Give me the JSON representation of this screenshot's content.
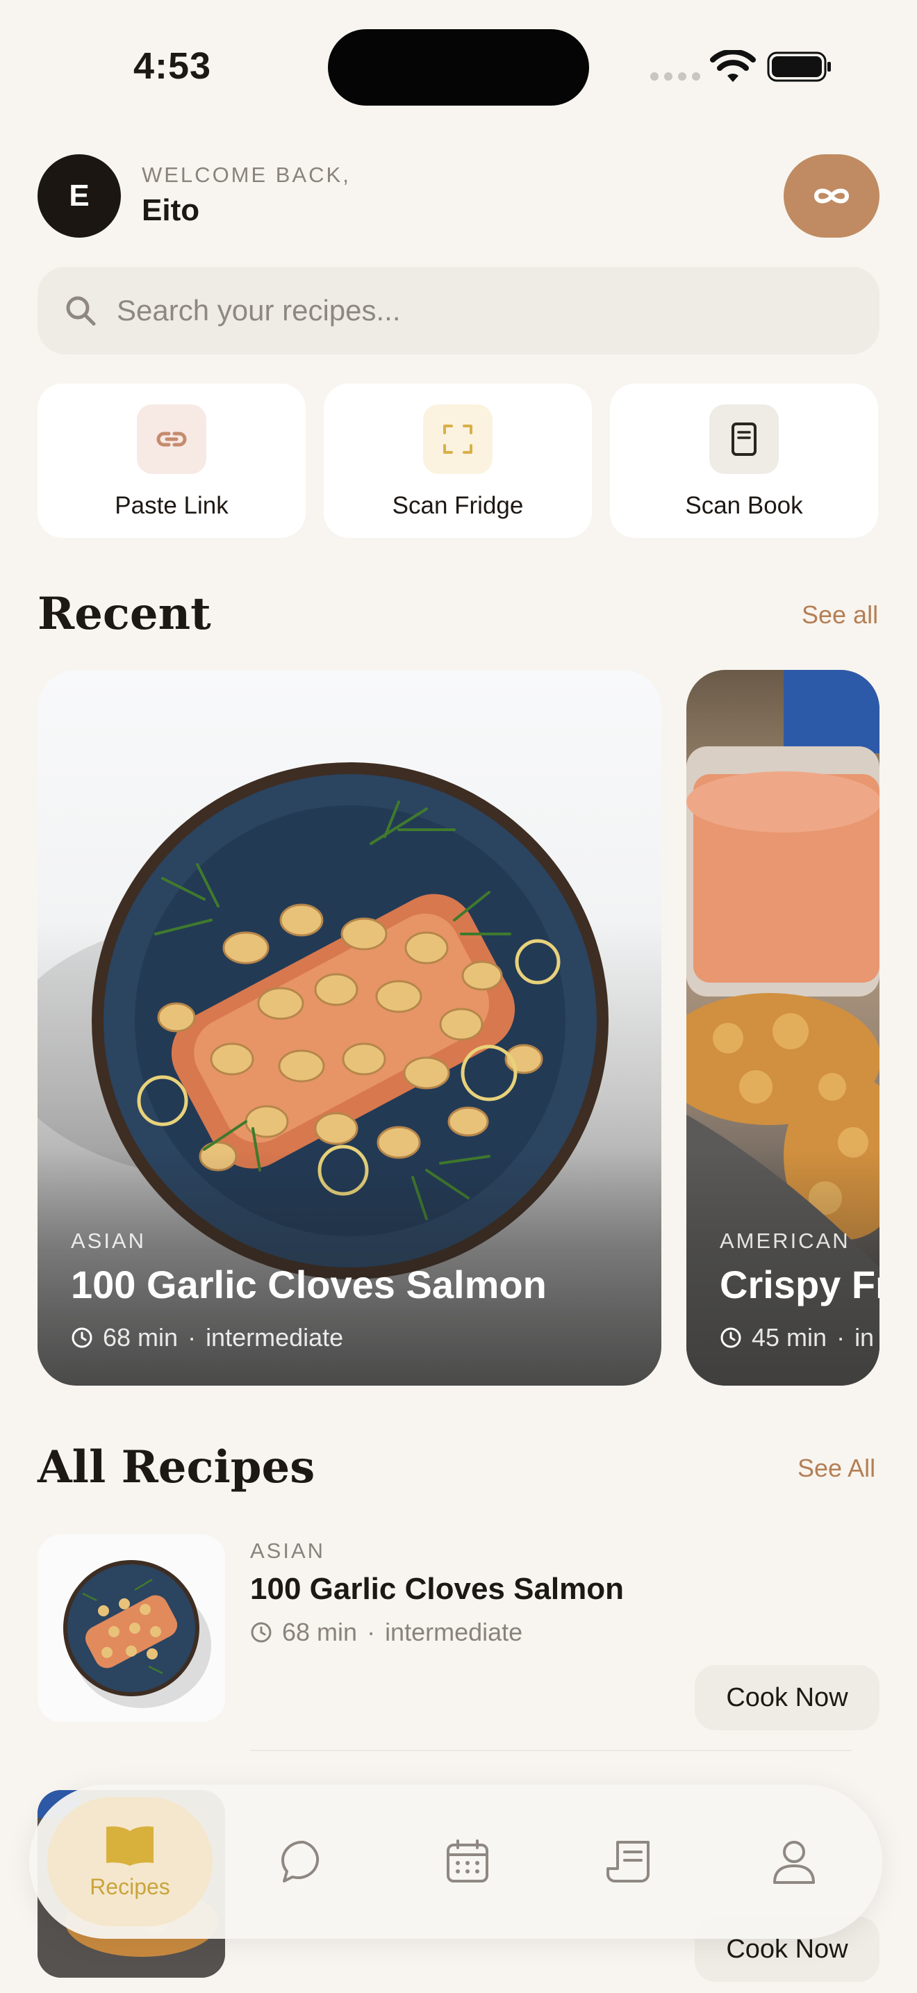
{
  "status_bar": {
    "time": "4:53"
  },
  "header": {
    "avatar_initial": "E",
    "welcome_label": "WELCOME BACK,",
    "user_name": "Eito",
    "premium_icon": "infinity-icon"
  },
  "search": {
    "placeholder": "Search your recipes..."
  },
  "quick_actions": [
    {
      "label": "Paste Link",
      "icon": "link-icon"
    },
    {
      "label": "Scan Fridge",
      "icon": "scan-frame-icon"
    },
    {
      "label": "Scan Book",
      "icon": "book-page-icon"
    }
  ],
  "recent": {
    "title": "Recent",
    "see_all": "See all",
    "cards": [
      {
        "category": "ASIAN",
        "title": "100 Garlic Cloves Salmon",
        "time": "68 min",
        "separator": "·",
        "difficulty": "intermediate"
      },
      {
        "category": "AMERICAN",
        "title": "Crispy Fr",
        "time": "45 min",
        "separator": "·",
        "difficulty": "in"
      }
    ]
  },
  "all_recipes": {
    "title": "All Recipes",
    "see_all": "See All",
    "items": [
      {
        "category": "ASIAN",
        "title": "100 Garlic Cloves Salmon",
        "time": "68 min",
        "separator": "·",
        "difficulty": "intermediate",
        "action": "Cook Now"
      },
      {
        "action": "Cook Now"
      }
    ]
  },
  "tab_bar": {
    "active_label": "Recipes",
    "tabs": [
      "book-icon",
      "chat-icon",
      "calendar-icon",
      "receipt-icon",
      "profile-icon"
    ]
  },
  "colors": {
    "background": "#f8f5f0",
    "accent": "#c08b62",
    "link": "#b47f55",
    "active_tab": "#caa43c"
  }
}
